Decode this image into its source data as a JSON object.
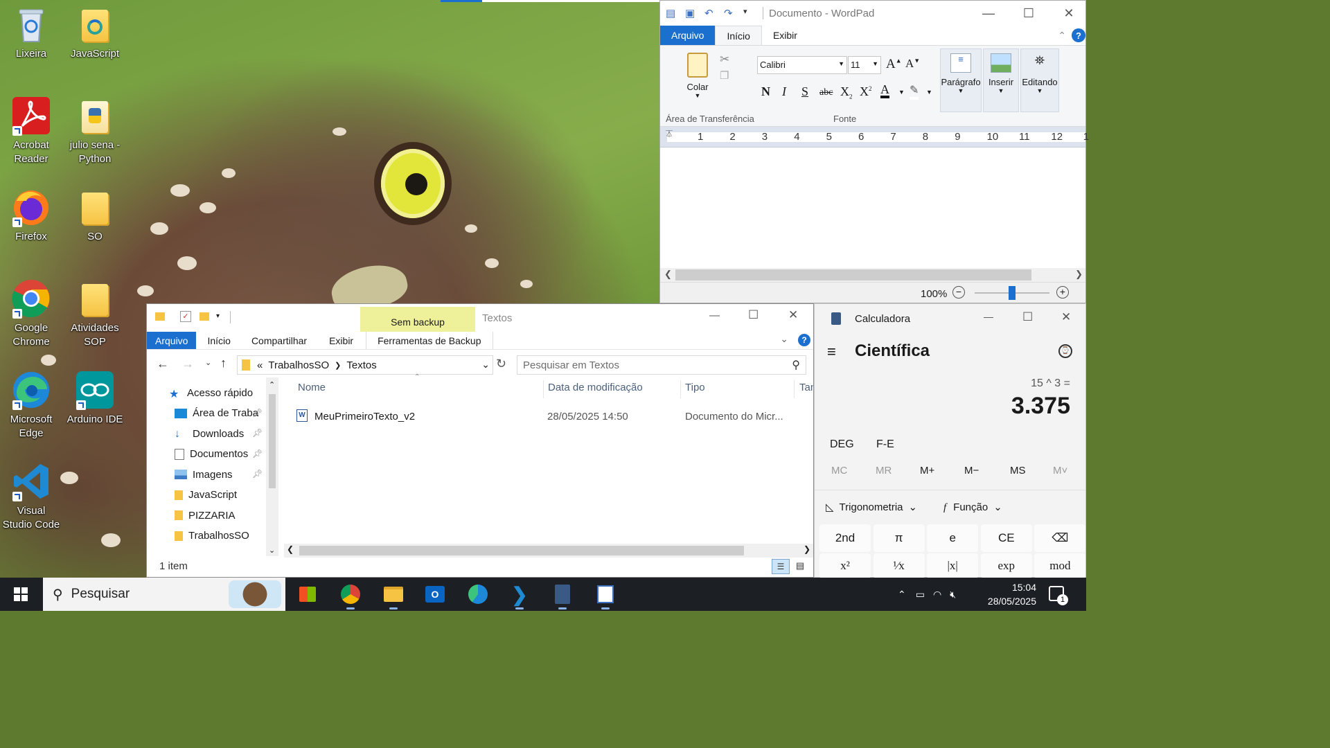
{
  "desktop": {
    "icons": [
      {
        "label": "Lixeira"
      },
      {
        "label": "JavaScript"
      },
      {
        "label": "Acrobat Reader"
      },
      {
        "label": "julio sena - Python"
      },
      {
        "label": "Firefox"
      },
      {
        "label": "SO"
      },
      {
        "label": "Google Chrome"
      },
      {
        "label": "Atividades SOP"
      },
      {
        "label": "Microsoft Edge"
      },
      {
        "label": "Arduino IDE"
      },
      {
        "label": "Visual Studio Code"
      }
    ]
  },
  "wordpad": {
    "title": "Documento - WordPad",
    "tabs": [
      "Arquivo",
      "Início",
      "Exibir"
    ],
    "clipboard": {
      "paste_label": "Colar",
      "group_label": "Área de Transferência"
    },
    "font": {
      "family": "Calibri",
      "size": "11",
      "group_label": "Fonte",
      "bold": "N",
      "italic": "I",
      "strike": "S",
      "abc": "abc"
    },
    "groups": [
      "Parágrafo",
      "Inserir",
      "Editando"
    ],
    "ruler": [
      "1",
      "2",
      "3",
      "4",
      "5",
      "6",
      "7",
      "8",
      "9",
      "10",
      "11",
      "12",
      "1"
    ],
    "zoom": "100%",
    "zoom_level": 0.5
  },
  "explorer": {
    "backup_group": "Sem backup",
    "title": "Textos",
    "tabs": [
      "Arquivo",
      "Início",
      "Compartilhar",
      "Exibir",
      "Ferramentas de Backup"
    ],
    "breadcrumb": {
      "root": "«",
      "parts": [
        "TrabalhosSO",
        "Textos"
      ]
    },
    "search_placeholder": "Pesquisar em Textos",
    "nav": [
      {
        "label": "Acesso rápido",
        "icon": "star-icon"
      },
      {
        "label": "Área de Traba",
        "icon": "desktop-icon",
        "pinned": true
      },
      {
        "label": "Downloads",
        "icon": "download-icon",
        "pinned": true
      },
      {
        "label": "Documentos",
        "icon": "document-icon",
        "pinned": true
      },
      {
        "label": "Imagens",
        "icon": "image-icon",
        "pinned": true
      },
      {
        "label": "JavaScript",
        "icon": "folder-icon"
      },
      {
        "label": "PIZZARIA",
        "icon": "folder-icon"
      },
      {
        "label": "TrabalhosSO",
        "icon": "folder-icon"
      }
    ],
    "columns": [
      "Nome",
      "Data de modificação",
      "Tipo",
      "Tan"
    ],
    "files": [
      {
        "name": "MeuPrimeiroTexto_v2",
        "modified": "28/05/2025 14:50",
        "type": "Documento do Micr..."
      }
    ],
    "status": "1 item"
  },
  "calculator": {
    "title": "Calculadora",
    "mode": "Científica",
    "expression": "15 ^ 3 =",
    "result": "3.375",
    "angle": "DEG",
    "fe": "F-E",
    "memory": [
      "MC",
      "MR",
      "M+",
      "M−",
      "MS",
      "M˅"
    ],
    "trig": "Trigonometria",
    "func": "Função",
    "row1": [
      "2nd",
      "π",
      "e",
      "CE",
      "⌫"
    ],
    "row2": [
      "x²",
      "¹⁄x",
      "|x|",
      "exp",
      "mod"
    ]
  },
  "taskbar": {
    "search_placeholder": "Pesquisar",
    "time": "15:04",
    "date": "28/05/2025",
    "notifications": "1"
  }
}
